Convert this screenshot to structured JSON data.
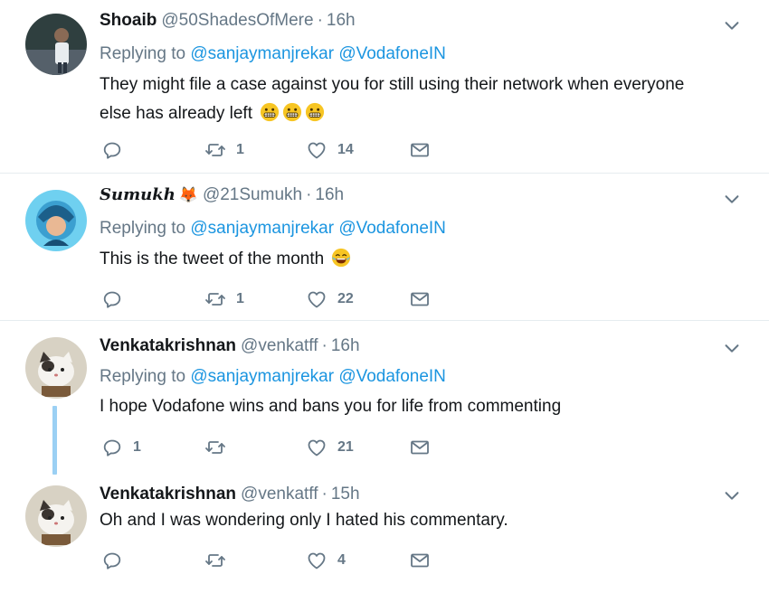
{
  "tweets": [
    {
      "name": "Shoaib",
      "handle": "@50ShadesOfMere",
      "time": "16h",
      "replying_label": "Replying to",
      "mentions": [
        "@sanjaymanjrekar",
        "@VodafoneIN"
      ],
      "text_line1": "They might file a case against you for still using their network when everyone",
      "text_line2": "else has already left",
      "emojis": [
        "grimacing-face",
        "grimacing-face",
        "grimacing-face"
      ],
      "reply_count": "",
      "retweet_count": "1",
      "like_count": "14"
    },
    {
      "name": "Sumukh",
      "name_emoji": "🦊",
      "handle": "@21Sumukh",
      "time": "16h",
      "replying_label": "Replying to",
      "mentions": [
        "@sanjaymanjrekar",
        "@VodafoneIN"
      ],
      "text": "This is the tweet of the month",
      "emojis": [
        "face-with-tears-of-joy"
      ],
      "reply_count": "",
      "retweet_count": "1",
      "like_count": "22"
    },
    {
      "name": "Venkatakrishnan",
      "handle": "@venkatff",
      "time": "16h",
      "replying_label": "Replying to",
      "mentions": [
        "@sanjaymanjrekar",
        "@VodafoneIN"
      ],
      "text": "I hope Vodafone wins and bans you for life from commenting",
      "reply_count": "1",
      "retweet_count": "",
      "like_count": "21"
    },
    {
      "name": "Venkatakrishnan",
      "handle": "@venkatff",
      "time": "15h",
      "text": "Oh and I was wondering only I hated his commentary.",
      "reply_count": "",
      "retweet_count": "",
      "like_count": "4"
    }
  ],
  "separator": "·",
  "icons": {
    "reply": "reply-icon",
    "retweet": "retweet-icon",
    "like": "heart-icon",
    "dm": "envelope-icon",
    "menu": "chevron-down-icon"
  },
  "colors": {
    "link": "#1b95e0",
    "muted": "#657786",
    "thread": "#9bd0f4"
  }
}
